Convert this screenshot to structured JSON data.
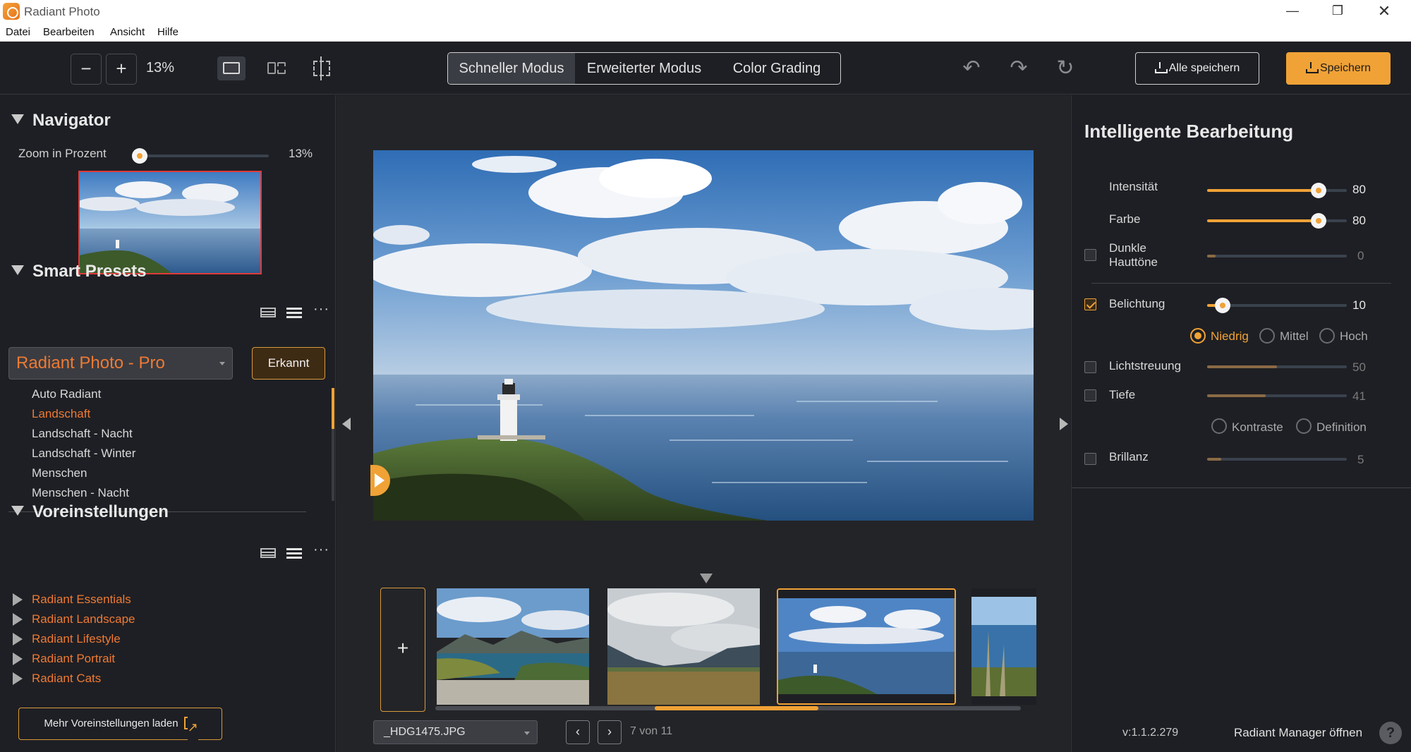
{
  "window": {
    "title": "Radiant Photo",
    "minimize": "—",
    "maximize": "❐",
    "close": "✕"
  },
  "menu": [
    "Datei",
    "Bearbeiten",
    "Ansicht",
    "Hilfe"
  ],
  "toolbar": {
    "zoom_out": "−",
    "zoom_in": "+",
    "zoom_value": "13%",
    "modes": [
      "Schneller Modus",
      "Erweiterter Modus",
      "Color Grading"
    ],
    "active_mode": "Schneller Modus",
    "undo": "↶",
    "redo": "↷",
    "reset": "↻",
    "save_all": "Alle speichern",
    "save": "Speichern"
  },
  "navigator": {
    "title": "Navigator",
    "zoom_label": "Zoom in Prozent",
    "zoom_value": "13%",
    "zoom_fraction": 0.05
  },
  "smart_presets": {
    "title": "Smart Presets",
    "selected_set": "Radiant Photo - Pro",
    "detected_button": "Erkannt",
    "items": [
      "Auto Radiant",
      "Landschaft",
      "Landschaft - Nacht",
      "Landschaft - Winter",
      "Menschen",
      "Menschen - Nacht"
    ],
    "active_item": "Landschaft"
  },
  "presets": {
    "title": "Voreinstellungen",
    "groups": [
      "Radiant Essentials",
      "Radiant Landscape",
      "Radiant Lifestyle",
      "Radiant Portrait",
      "Radiant Cats"
    ],
    "load_more": "Mehr Voreinstellungen laden"
  },
  "filmstrip": {
    "add_label": "+",
    "file_name": "_HDG1475.JPG",
    "prev": "‹",
    "next": "›",
    "counter": "7 von 11"
  },
  "smart_editing": {
    "title": "Intelligente Bearbeitung",
    "sliders": [
      {
        "label": "Intensität",
        "value": "80",
        "fraction": 0.8,
        "checkbox": false,
        "enabled": true
      },
      {
        "label": "Farbe",
        "value": "80",
        "fraction": 0.8,
        "checkbox": false,
        "enabled": true
      },
      {
        "label": "Dunkle Hauttöne",
        "value": "0",
        "fraction": 0.0,
        "checkbox": true,
        "checked": false,
        "enabled": false
      },
      {
        "label": "Belichtung",
        "value": "10",
        "fraction": 0.1,
        "checkbox": true,
        "checked": true,
        "enabled": true
      },
      {
        "label": "Lichtstreuung",
        "value": "50",
        "fraction": 0.5,
        "checkbox": true,
        "checked": false,
        "enabled": false
      },
      {
        "label": "Tiefe",
        "value": "41",
        "fraction": 0.41,
        "checkbox": true,
        "checked": false,
        "enabled": false
      },
      {
        "label": "Brillanz",
        "value": "5",
        "fraction": 0.05,
        "checkbox": true,
        "checked": false,
        "enabled": false
      }
    ],
    "exposure_levels": [
      "Niedrig",
      "Mittel",
      "Hoch"
    ],
    "exposure_selected": "Niedrig",
    "depth_modes": [
      "Kontraste",
      "Definition"
    ],
    "depth_selected": "Definition"
  },
  "footer": {
    "version": "v:1.1.2.279",
    "manager_link": "Radiant Manager öffnen",
    "help": "?"
  },
  "colors": {
    "accent": "#f0a236",
    "preset_accent": "#ee7a33",
    "background": "#1e1f24"
  }
}
